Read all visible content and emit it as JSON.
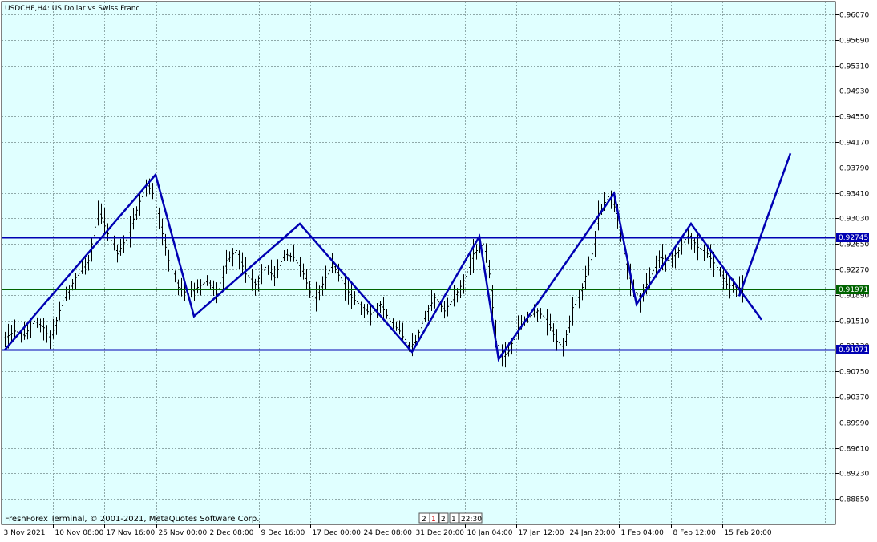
{
  "header": {
    "symbol_info": "USDCHF,H4:  US Dollar vs Swiss Franc"
  },
  "footer": {
    "copyright": "FreshForex Terminal, © 2001-2021, MetaQuotes Software Corp.",
    "scroll_marks": [
      "2",
      "1",
      "2",
      "1",
      "22:30"
    ]
  },
  "colors": {
    "background": "#e0ffff",
    "grid": "#8fa9a9",
    "bars": "#000000",
    "trendlines": "#0000b3",
    "current_price_line": "#006400",
    "price_label_blue": "#0000b3",
    "price_label_green": "#006400"
  },
  "chart_data": {
    "type": "ohlc",
    "ylim": [
      0.8847,
      0.9626
    ],
    "y_ticks": [
      "0.96070",
      "0.95690",
      "0.95310",
      "0.94930",
      "0.94550",
      "0.94170",
      "0.93790",
      "0.93410",
      "0.93030",
      "0.92650",
      "0.92270",
      "0.91890",
      "0.91510",
      "0.91130",
      "0.90750",
      "0.90370",
      "0.89990",
      "0.89610",
      "0.89230",
      "0.88850"
    ],
    "x_ticks": [
      "3 Nov 2021",
      "10 Nov 08:00",
      "17 Nov 16:00",
      "25 Nov 00:00",
      "2 Dec 08:00",
      "9 Dec 16:00",
      "17 Dec 00:00",
      "24 Dec 08:00",
      "31 Dec 20:00",
      "10 Jan 04:00",
      "17 Jan 12:00",
      "24 Jan 20:00",
      "1 Feb 04:00",
      "8 Feb 12:00",
      "15 Feb 20:00"
    ],
    "price_anchors": [
      {
        "bar": 0,
        "price": 0.9125
      },
      {
        "bar": 3,
        "price": 0.9135
      },
      {
        "bar": 6,
        "price": 0.9128
      },
      {
        "bar": 9,
        "price": 0.915
      },
      {
        "bar": 12,
        "price": 0.914
      },
      {
        "bar": 14,
        "price": 0.9122
      },
      {
        "bar": 18,
        "price": 0.918
      },
      {
        "bar": 22,
        "price": 0.9215
      },
      {
        "bar": 26,
        "price": 0.924
      },
      {
        "bar": 29,
        "price": 0.9315
      },
      {
        "bar": 32,
        "price": 0.928
      },
      {
        "bar": 35,
        "price": 0.925
      },
      {
        "bar": 38,
        "price": 0.9275
      },
      {
        "bar": 41,
        "price": 0.9315
      },
      {
        "bar": 44,
        "price": 0.9355
      },
      {
        "bar": 46,
        "price": 0.934
      },
      {
        "bar": 48,
        "price": 0.93
      },
      {
        "bar": 51,
        "price": 0.924
      },
      {
        "bar": 54,
        "price": 0.92
      },
      {
        "bar": 57,
        "price": 0.919
      },
      {
        "bar": 60,
        "price": 0.92
      },
      {
        "bar": 63,
        "price": 0.921
      },
      {
        "bar": 66,
        "price": 0.919
      },
      {
        "bar": 69,
        "price": 0.924
      },
      {
        "bar": 72,
        "price": 0.9255
      },
      {
        "bar": 75,
        "price": 0.922
      },
      {
        "bar": 78,
        "price": 0.9205
      },
      {
        "bar": 81,
        "price": 0.923
      },
      {
        "bar": 84,
        "price": 0.9215
      },
      {
        "bar": 87,
        "price": 0.925
      },
      {
        "bar": 90,
        "price": 0.9245
      },
      {
        "bar": 93,
        "price": 0.922
      },
      {
        "bar": 96,
        "price": 0.918
      },
      {
        "bar": 99,
        "price": 0.9205
      },
      {
        "bar": 102,
        "price": 0.9235
      },
      {
        "bar": 105,
        "price": 0.921
      },
      {
        "bar": 108,
        "price": 0.9185
      },
      {
        "bar": 111,
        "price": 0.9172
      },
      {
        "bar": 114,
        "price": 0.916
      },
      {
        "bar": 117,
        "price": 0.9175
      },
      {
        "bar": 120,
        "price": 0.915
      },
      {
        "bar": 123,
        "price": 0.9135
      },
      {
        "bar": 126,
        "price": 0.911
      },
      {
        "bar": 128,
        "price": 0.912
      },
      {
        "bar": 131,
        "price": 0.916
      },
      {
        "bar": 134,
        "price": 0.9185
      },
      {
        "bar": 137,
        "price": 0.9165
      },
      {
        "bar": 140,
        "price": 0.9185
      },
      {
        "bar": 143,
        "price": 0.921
      },
      {
        "bar": 146,
        "price": 0.925
      },
      {
        "bar": 149,
        "price": 0.9265
      },
      {
        "bar": 151,
        "price": 0.922
      },
      {
        "bar": 153,
        "price": 0.912
      },
      {
        "bar": 155,
        "price": 0.9095
      },
      {
        "bar": 157,
        "price": 0.9105
      },
      {
        "bar": 160,
        "price": 0.914
      },
      {
        "bar": 163,
        "price": 0.9155
      },
      {
        "bar": 166,
        "price": 0.9165
      },
      {
        "bar": 169,
        "price": 0.915
      },
      {
        "bar": 172,
        "price": 0.912
      },
      {
        "bar": 174,
        "price": 0.911
      },
      {
        "bar": 177,
        "price": 0.917
      },
      {
        "bar": 180,
        "price": 0.92
      },
      {
        "bar": 183,
        "price": 0.925
      },
      {
        "bar": 185,
        "price": 0.931
      },
      {
        "bar": 188,
        "price": 0.9335
      },
      {
        "bar": 190,
        "price": 0.932
      },
      {
        "bar": 192,
        "price": 0.928
      },
      {
        "bar": 194,
        "price": 0.922
      },
      {
        "bar": 196,
        "price": 0.9195
      },
      {
        "bar": 198,
        "price": 0.9185
      },
      {
        "bar": 201,
        "price": 0.9215
      },
      {
        "bar": 204,
        "price": 0.9245
      },
      {
        "bar": 207,
        "price": 0.924
      },
      {
        "bar": 210,
        "price": 0.9255
      },
      {
        "bar": 213,
        "price": 0.928
      },
      {
        "bar": 216,
        "price": 0.926
      },
      {
        "bar": 219,
        "price": 0.925
      },
      {
        "bar": 222,
        "price": 0.923
      },
      {
        "bar": 225,
        "price": 0.9205
      },
      {
        "bar": 228,
        "price": 0.92
      },
      {
        "bar": 231,
        "price": 0.9197
      }
    ],
    "price_labels": [
      {
        "value": 0.92745,
        "label": "0.92745",
        "color": "blue"
      },
      {
        "value": 0.91971,
        "label": "0.91971",
        "color": "green"
      },
      {
        "value": 0.91071,
        "label": "0.91071",
        "color": "blue"
      }
    ],
    "horizontal_lines": [
      {
        "price": 0.92745,
        "color": "blue"
      },
      {
        "price": 0.91971,
        "color": "green"
      },
      {
        "price": 0.91071,
        "color": "blue"
      }
    ],
    "zigzag": [
      {
        "bar": 0,
        "price": 0.9107
      },
      {
        "bar": 47,
        "price": 0.9368
      },
      {
        "bar": 59,
        "price": 0.9157
      },
      {
        "bar": 92,
        "price": 0.9295
      },
      {
        "bar": 127,
        "price": 0.9104
      },
      {
        "bar": 148,
        "price": 0.9276
      },
      {
        "bar": 154,
        "price": 0.9093
      },
      {
        "bar": 190,
        "price": 0.934
      },
      {
        "bar": 197,
        "price": 0.9175
      },
      {
        "bar": 214,
        "price": 0.9295
      },
      {
        "bar": 236,
        "price": 0.9152
      }
    ],
    "projection_line": [
      {
        "bar": 229,
        "price": 0.9187
      },
      {
        "bar": 245,
        "price": 0.94
      }
    ]
  }
}
